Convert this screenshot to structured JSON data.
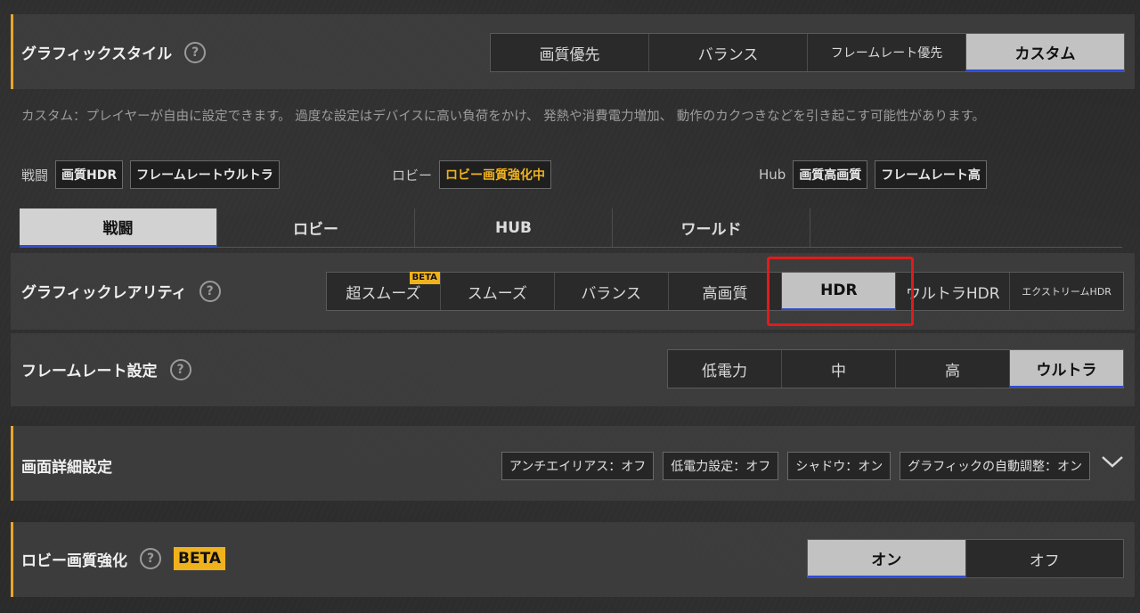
{
  "graphic_style": {
    "title": "グラフィックスタイル",
    "help": "?",
    "options": [
      "画質優先",
      "バランス",
      "フレームレート優先",
      "カスタム"
    ],
    "selected": "カスタム"
  },
  "description": "カスタム：プレイヤーが自由に設定できます。 過度な設定はデバイスに高い負荷をかけ、 発熱や消費電力増加、 動作のカクつきなどを引き起こす可能性があります。",
  "summary": {
    "battle_label": "戦闘",
    "battle_tags": [
      "画質HDR",
      "フレームレートウルトラ"
    ],
    "lobby_label": "ロビー",
    "lobby_tags": [
      "ロビー画質強化中"
    ],
    "hub_label": "Hub",
    "hub_tags": [
      "画質高画質",
      "フレームレート高"
    ]
  },
  "tabs": [
    "戦闘",
    "ロビー",
    "HUB",
    "ワールド"
  ],
  "active_tab": "戦闘",
  "graphic_rarity": {
    "title": "グラフィックレアリティ",
    "help": "?",
    "options": [
      "超スムーズ",
      "スムーズ",
      "バランス",
      "高画質",
      "HDR",
      "ウルトラHDR",
      "エクストリームHDR"
    ],
    "beta_label": "BETA",
    "selected": "HDR"
  },
  "frame_rate": {
    "title": "フレームレート設定",
    "help": "?",
    "options": [
      "低電力",
      "中",
      "高",
      "ウルトラ"
    ],
    "selected": "ウルトラ"
  },
  "detail": {
    "title": "画面詳細設定",
    "chips": [
      "アンチエイリアス：オフ",
      "低電力設定：オフ",
      "シャドウ：オン",
      "グラフィックの自動調整：オン"
    ],
    "expand_icon": "chevron-down-icon"
  },
  "lobby_enhance": {
    "title": "ロビー画質強化",
    "help": "?",
    "beta": "BETA",
    "options": [
      "オン",
      "オフ"
    ],
    "selected": "オン"
  },
  "colors": {
    "accent": "#e7a72a",
    "selected_underline": "#2f4bd6",
    "highlight_box": "#e11b1b"
  }
}
